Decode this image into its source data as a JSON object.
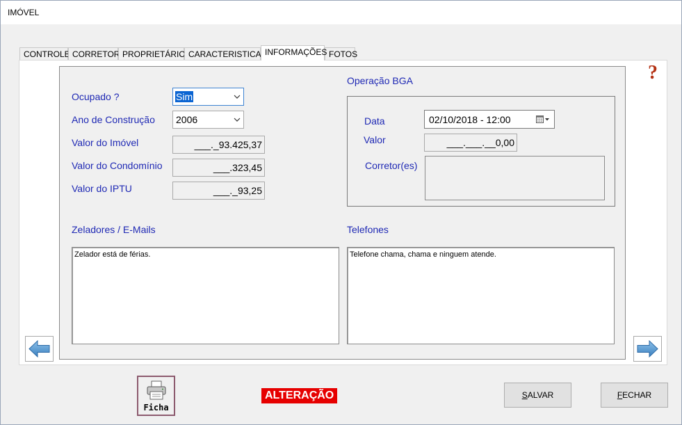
{
  "window": {
    "title": "IMÓVEL"
  },
  "tabs": [
    {
      "label": "CONTROLE"
    },
    {
      "label": "CORRETOR"
    },
    {
      "label": "PROPRIETÁRIO"
    },
    {
      "label": "CARACTERISTICAS"
    },
    {
      "label": "INFORMAÇÕES",
      "active": true
    },
    {
      "label": "FOTOS"
    }
  ],
  "help": {
    "glyph": "?"
  },
  "form": {
    "ocupado": {
      "label": "Ocupado ?",
      "value": "Sim"
    },
    "ano": {
      "label": "Ano de Construção",
      "value": "2006"
    },
    "valor_imovel": {
      "label": "Valor do Imóvel",
      "value": "___._93.425,37"
    },
    "valor_condominio": {
      "label": "Valor do Condomínio",
      "value": "___.323,45"
    },
    "valor_iptu": {
      "label": "Valor do IPTU",
      "value": "___._93,25"
    }
  },
  "operacao": {
    "title": "Operação BGA",
    "data": {
      "label": "Data",
      "value": "02/10/2018  - 12:00"
    },
    "valor": {
      "label": "Valor",
      "value": "___.___.__0,00"
    },
    "corretor": {
      "label": "Corretor(es)",
      "value": ""
    }
  },
  "zeladores": {
    "label": "Zeladores / E-Mails",
    "text": "Zelador está de férias."
  },
  "telefones": {
    "label": "Telefones",
    "text": "Telefone chama, chama e ninguem atende."
  },
  "footer": {
    "ficha_label": "Ficha",
    "status": "ALTERAÇÃO",
    "save_label": "SALVAR",
    "save_mnemonic": "S",
    "save_rest": "ALVAR",
    "close_label": "FECHAR",
    "close_mnemonic": "F",
    "close_rest": "ECHAR"
  },
  "colors": {
    "label_blue": "#1e28b4",
    "status_red": "#e60000",
    "selection": "#0a64d2",
    "nav_arrow": "#4a90c8"
  }
}
